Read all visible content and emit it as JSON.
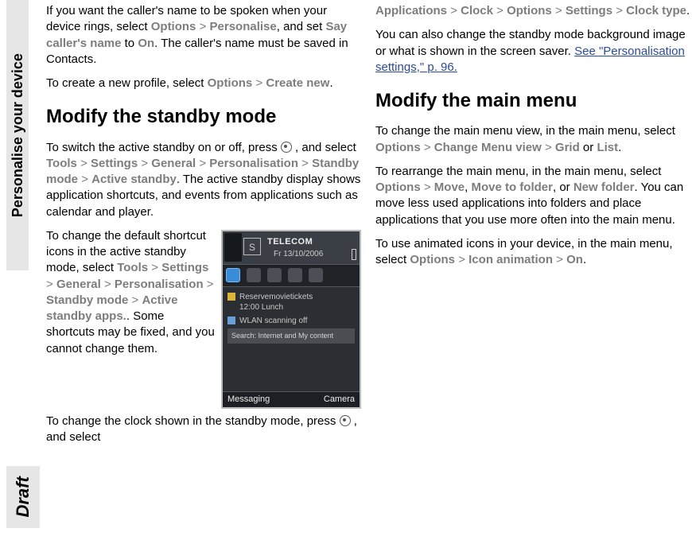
{
  "sidebar": {
    "label": "Personalise your device"
  },
  "draft": {
    "label": "Draft"
  },
  "left": {
    "p1": {
      "a": "If you want the caller's name to be spoken when your device rings, select ",
      "b": "Options",
      "c": "Personalise",
      "d": ", and set ",
      "e": "Say caller's name",
      "f": " to ",
      "g": "On",
      "h": ". The caller's name must be saved in Contacts."
    },
    "p2": {
      "a": "To create a new profile, select ",
      "b": "Options",
      "c": "Create new",
      "d": "."
    },
    "h1": "Modify the standby mode",
    "p3": {
      "a": "To switch the active standby on or off, press ",
      "b": " , and select ",
      "c": "Tools",
      "d": "Settings",
      "e": "General",
      "f": "Personalisation",
      "g": "Standby mode",
      "h": "Active standby",
      "i": ". The active standby display shows application shortcuts, and events from applications such as calendar and player."
    },
    "p4": {
      "a": "To change the default shortcut icons in the active standby mode, select ",
      "b": "Tools",
      "c": "Settings",
      "d": "General",
      "e": "Personalisation",
      "f": "Standby mode",
      "g": "Active standby apps.",
      "h": ". Some shortcuts may be fixed, and you cannot change them."
    },
    "p5": {
      "a": "To change the clock shown in the standby mode, press ",
      "b": " , and select"
    }
  },
  "phone": {
    "s": "S",
    "telecom": "TELECOM",
    "date": "Fr 13/10/2006",
    "row1a": "Reservemovietickets",
    "row1b": "12:00 Lunch",
    "row2": "WLAN scanning off",
    "search": "Search: Internet and My content",
    "left": "Messaging",
    "right": "Camera"
  },
  "right": {
    "p1": {
      "a": "Applications",
      "b": "Clock",
      "c": "Options",
      "d": "Settings",
      "e": "Clock type",
      "f": "."
    },
    "p2": {
      "a": "You can also change the standby mode background image or what is shown in the screen saver. ",
      "b": "See \"Personalisation settings,\" p. 96."
    },
    "h1": "Modify the main menu",
    "p3": {
      "a": "To change the main menu view, in the main menu, select ",
      "b": "Options",
      "c": "Change Menu view",
      "d": "Grid",
      "e": " or ",
      "f": "List",
      "g": "."
    },
    "p4": {
      "a": "To rearrange the main menu, in the main menu, select ",
      "b": "Options",
      "c": "Move",
      "d": ", ",
      "e": "Move to folder",
      "f": ", or ",
      "g": "New folder",
      "h": ". You can move less used applications into folders and place applications that you use more often into the main menu."
    },
    "p5": {
      "a": "To use animated icons in your device, in the main menu, select ",
      "b": "Options",
      "c": "Icon animation",
      "d": "On",
      "e": "."
    }
  },
  "sep": ">"
}
